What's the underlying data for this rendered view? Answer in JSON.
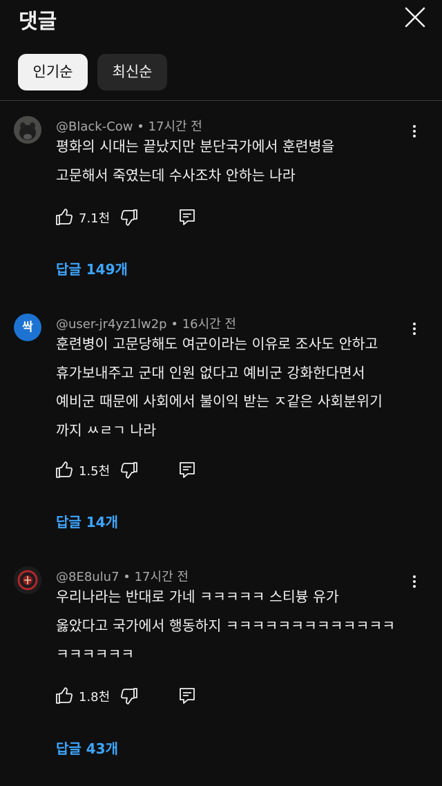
{
  "header": {
    "title": "댓글",
    "close_icon": "close-icon"
  },
  "sort": {
    "popular": "인기순",
    "newest": "최신순"
  },
  "comments": [
    {
      "avatar_text": "",
      "author": "@Black-Cow",
      "time": "17시간 전",
      "lines": [
        "평화의 시대는 끝났지만 분단국가에서 훈련병을",
        "고문해서 죽였는데 수사조차 안하는 나라"
      ],
      "likes": "7.1천",
      "replies": "답글 149개"
    },
    {
      "avatar_text": "싹",
      "author": "@user-jr4yz1lw2p",
      "time": "16시간 전",
      "lines": [
        "훈련병이 고문당해도 여군이라는 이유로 조사도 안하고",
        "휴가보내주고 군대 인원 없다고 예비군 강화한다면서",
        "예비군 때문에 사회에서 불이익 받는 ㅈ같은 사회분위기",
        "까지 ㅆㄹㄱ 나라"
      ],
      "likes": "1.5천",
      "replies": "답글 14개"
    },
    {
      "avatar_text": "",
      "author": "@8E8ulu7",
      "time": "17시간 전",
      "lines": [
        "우리나라는 반대로 가네 ㅋㅋㅋㅋㅋ 스티븅 유가",
        "옳았다고 국가에서 행동하지 ㅋㅋㅋㅋㅋㅋㅋㅋㅋㅋㅋㅋㅋ",
        "ㅋㅋㅋㅋㅋㅋ"
      ],
      "likes": "1.8천",
      "replies": "답글 43개"
    }
  ]
}
